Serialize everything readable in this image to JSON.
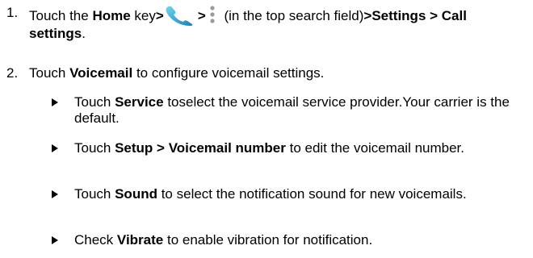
{
  "steps": [
    {
      "number": "1.",
      "parts": {
        "a": "Touch the ",
        "b": "Home",
        "c": " key",
        "d": ">",
        "e": ">",
        "f": " (in the top search field)",
        "g": ">Settings > Call settings",
        "h": "."
      }
    },
    {
      "number": "2.",
      "parts": {
        "a": "Touch ",
        "b": "Voicemail",
        "c": " to configure voicemail settings."
      }
    }
  ],
  "substeps": [
    {
      "a": "Touch ",
      "b": "Service",
      "c": " toselect the voicemail service provider.Your carrier is the default."
    },
    {
      "a": "Touch ",
      "b": "Setup > Voicemail number",
      "c": " to edit the voicemail number."
    },
    {
      "a": "Touch ",
      "b": "Sound",
      "c": " to select the notification sound for new voicemails."
    },
    {
      "a": "Check ",
      "b": "Vibrate",
      "c": " to enable vibration for notification."
    }
  ],
  "icons": {
    "phone": "phone-app-icon",
    "menu": "vertical-dots-menu-icon",
    "bullet": "triangle-bullet-icon"
  },
  "colors": {
    "text": "#000000",
    "phone_icon_light": "#5cc8e8",
    "phone_icon_dark": "#1d7fb8",
    "menu_icon": "#9a9a9a"
  }
}
